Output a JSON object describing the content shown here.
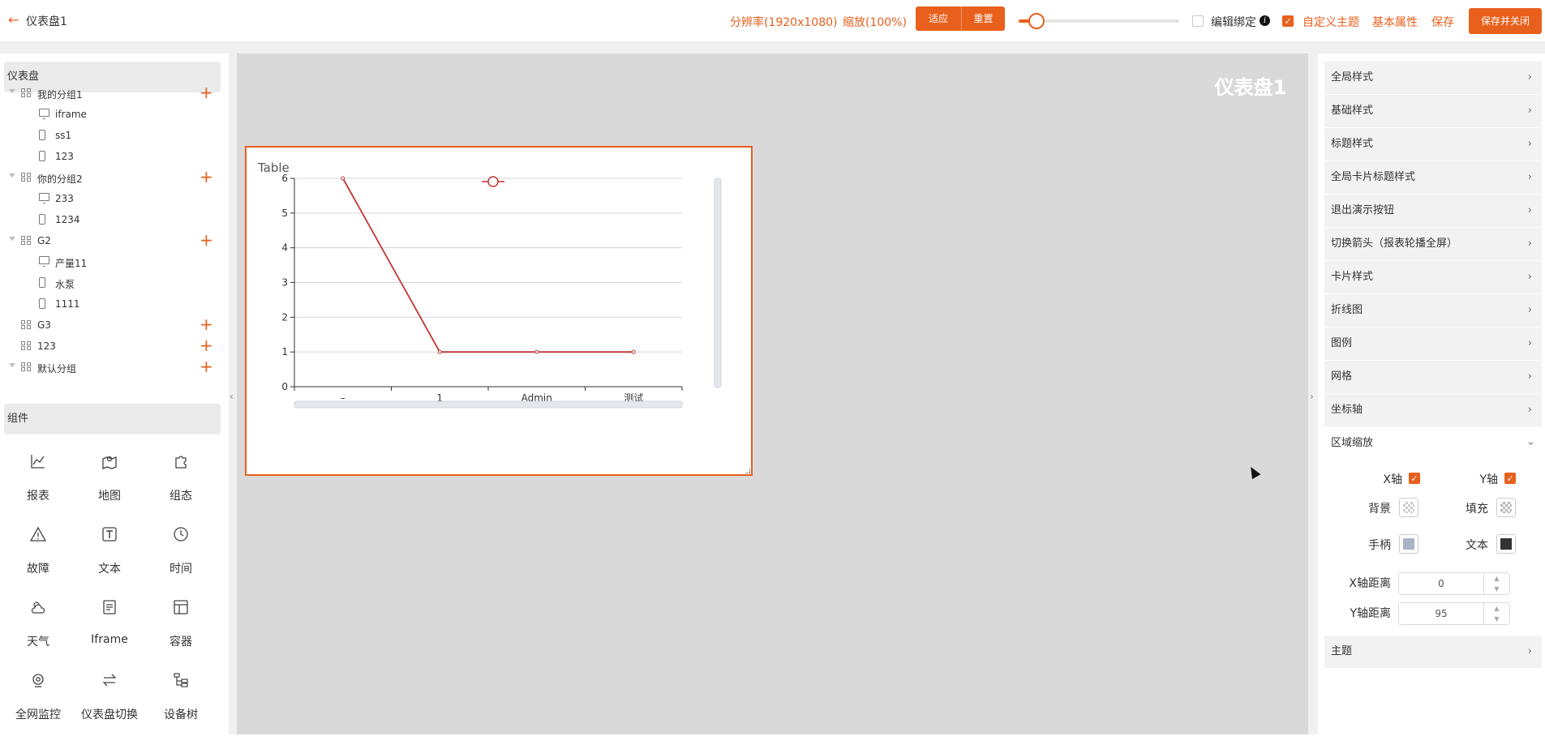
{
  "header": {
    "back_icon": "arrow-left-icon",
    "title": "仪表盘1",
    "resolution": "分辨率(1920x1080)",
    "zoom": "缩放(100%)",
    "fit_label": "适应",
    "reset_label": "重置",
    "zoom_slider_value": 0.1,
    "edit_binding_label": "编辑绑定",
    "edit_binding_checked": false,
    "custom_theme_label": "自定义主题",
    "custom_theme_checked": true,
    "basic_props_label": "基本属性",
    "save_label": "保存",
    "save_close_label": "保存并关闭",
    "accent_color": "#e8601c"
  },
  "left": {
    "dashboard_section": "仪表盘",
    "tree": [
      {
        "type": "group",
        "label": "我的分组1",
        "expanded": true
      },
      {
        "type": "item",
        "label": "iframe",
        "device": "monitor-icon"
      },
      {
        "type": "item",
        "label": "ss1",
        "device": "phone-icon"
      },
      {
        "type": "item",
        "label": "123",
        "device": "phone-icon"
      },
      {
        "type": "group",
        "label": "你的分组2",
        "expanded": true
      },
      {
        "type": "item",
        "label": "233",
        "device": "monitor-icon"
      },
      {
        "type": "item",
        "label": "1234",
        "device": "phone-icon"
      },
      {
        "type": "group",
        "label": "G2",
        "expanded": true
      },
      {
        "type": "item",
        "label": "产量11",
        "device": "monitor-icon"
      },
      {
        "type": "item",
        "label": "水泵",
        "device": "phone-icon"
      },
      {
        "type": "item",
        "label": "1111",
        "device": "phone-icon"
      },
      {
        "type": "group",
        "label": "G3",
        "expanded": false
      },
      {
        "type": "group",
        "label": "123",
        "expanded": false
      },
      {
        "type": "group",
        "label": "默认分组",
        "expanded": true
      }
    ],
    "components_section": "组件",
    "components": [
      {
        "label": "报表",
        "icon": "line-chart-icon"
      },
      {
        "label": "地图",
        "icon": "map-icon"
      },
      {
        "label": "组态",
        "icon": "puzzle-icon"
      },
      {
        "label": "故障",
        "icon": "warning-icon"
      },
      {
        "label": "文本",
        "icon": "text-icon"
      },
      {
        "label": "时间",
        "icon": "clock-icon"
      },
      {
        "label": "天气",
        "icon": "weather-icon"
      },
      {
        "label": "Iframe",
        "icon": "iframe-icon"
      },
      {
        "label": "容器",
        "icon": "container-icon"
      },
      {
        "label": "全网监控",
        "icon": "camera-icon"
      },
      {
        "label": "仪表盘切换",
        "icon": "switch-icon"
      },
      {
        "label": "设备树",
        "icon": "device-tree-icon"
      }
    ]
  },
  "canvas": {
    "title": "仪表盘1",
    "card_title": "Table"
  },
  "chart_data": {
    "type": "line",
    "categories": [
      "–",
      "1",
      "Admin",
      "测试"
    ],
    "series": [
      {
        "values": [
          6,
          1,
          1,
          1
        ],
        "color": "#c23531"
      }
    ],
    "ylim": [
      0,
      6
    ],
    "yticks": [
      0,
      1,
      2,
      3,
      4,
      5,
      6
    ],
    "grid": true,
    "legend": "top",
    "legend_marker": "circle",
    "datazoom_x": true,
    "datazoom_y": true
  },
  "right": {
    "sections": [
      {
        "label": "全局样式",
        "open": false
      },
      {
        "label": "基础样式",
        "open": false
      },
      {
        "label": "标题样式",
        "open": false
      },
      {
        "label": "全局卡片标题样式",
        "open": false
      },
      {
        "label": "退出演示按钮",
        "open": false
      },
      {
        "label": "切换箭头（报表轮播全屏）",
        "open": false
      },
      {
        "label": "卡片样式",
        "open": false
      },
      {
        "label": "折线图",
        "open": false
      },
      {
        "label": "图例",
        "open": false
      },
      {
        "label": "网格",
        "open": false
      },
      {
        "label": "坐标轴",
        "open": false
      },
      {
        "label": "区域缩放",
        "open": true
      }
    ],
    "zoom_area": {
      "x_axis_label": "X轴",
      "x_axis_checked": true,
      "y_axis_label": "Y轴",
      "y_axis_checked": true,
      "background_label": "背景",
      "fill_label": "填充",
      "handle_label": "手柄",
      "handle_color": "#a9b3c8",
      "text_label": "文本",
      "text_color": "#333333",
      "x_distance_label": "X轴距离",
      "x_distance_value": "0",
      "y_distance_label": "Y轴距离",
      "y_distance_value": "95"
    },
    "theme_section": "主题"
  }
}
